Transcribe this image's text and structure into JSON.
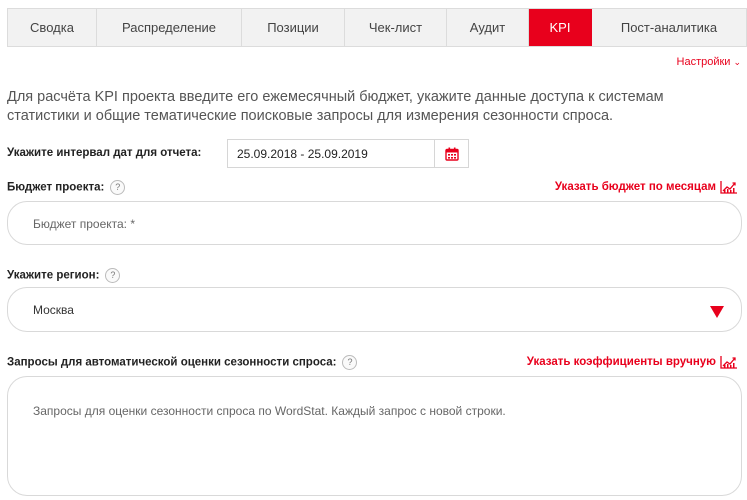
{
  "tabs": [
    {
      "label": "Сводка",
      "active": false
    },
    {
      "label": "Распределение",
      "active": false
    },
    {
      "label": "Позиции",
      "active": false
    },
    {
      "label": "Чек-лист",
      "active": false
    },
    {
      "label": "Аудит",
      "active": false
    },
    {
      "label": "KPI",
      "active": true
    },
    {
      "label": "Пост-аналитика",
      "active": false
    }
  ],
  "settings_label": "Настройки",
  "intro_text": "Для расчёта KPI проекта введите его ежемесячный бюджет, укажите данные доступа к системам статистики и общие тематические поисковые запросы для измерения сезонности спроса.",
  "date_interval": {
    "label": "Укажите интервал дат для отчета:",
    "value": "25.09.2018 - 25.09.2019"
  },
  "budget": {
    "label": "Бюджет проекта:",
    "help": "?",
    "link": "Указать бюджет по месяцам",
    "placeholder": "Бюджет проекта: *"
  },
  "region": {
    "label": "Укажите регион:",
    "help": "?",
    "value": "Москва"
  },
  "queries": {
    "label": "Запросы для автоматической оценки сезонности спроса:",
    "help": "?",
    "link": "Указать коэффициенты вручную",
    "placeholder": "Запросы для оценки сезонности спроса по WordStat. Каждый запрос с новой строки."
  },
  "colors": {
    "accent": "#e8001c",
    "tab_bg": "#f2f2f2",
    "border": "#d9d9d9"
  },
  "icons": {
    "calendar": "calendar-icon",
    "chart": "chart-growth-icon",
    "dropdown": "dropdown-arrow-icon"
  }
}
